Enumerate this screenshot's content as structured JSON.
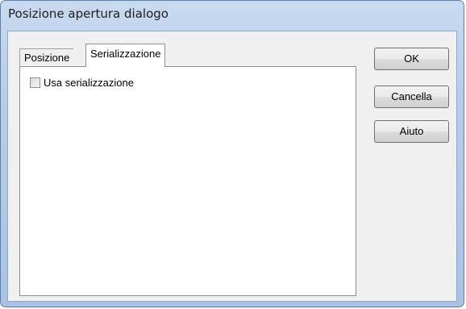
{
  "window": {
    "title": "Posizione apertura dialogo"
  },
  "tabs": [
    {
      "label": "Posizione",
      "active": false
    },
    {
      "label": "Serializzazione",
      "active": true
    }
  ],
  "panel": {
    "checkbox_label": "Usa serializzazione",
    "checkbox_checked": false
  },
  "buttons": {
    "ok_label": "OK",
    "cancel_label": "Cancella",
    "help_label": "Aiuto"
  },
  "colors": {
    "frame": "#b8cde9",
    "client": "#f0f0f0",
    "panel": "#ffffff"
  }
}
